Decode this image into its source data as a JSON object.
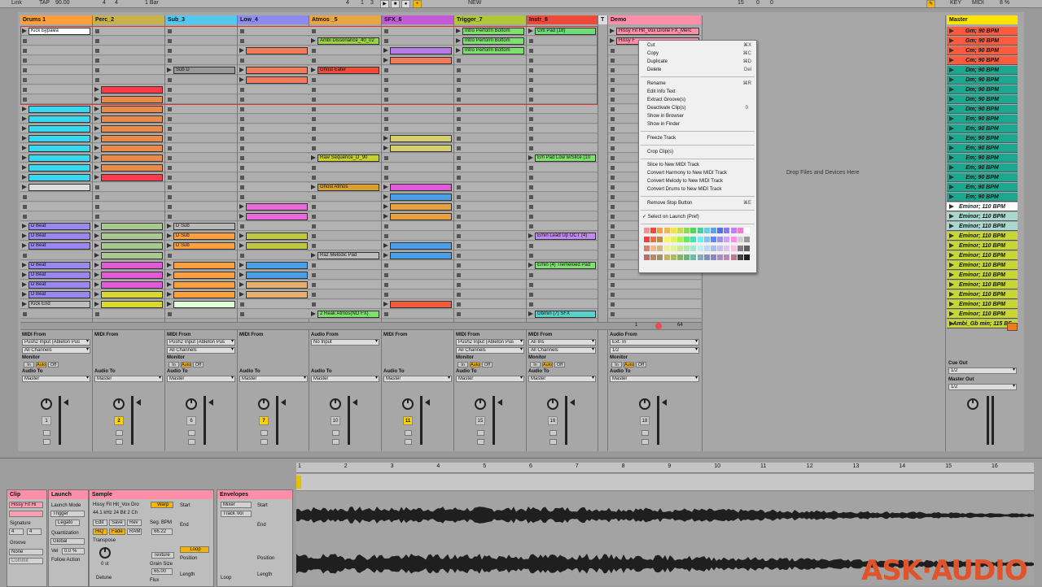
{
  "transport": {
    "link": "Link",
    "tap": "TAP",
    "tempo": "90.00",
    "sig1": "4",
    "sig2": "4",
    "quant": "1 Bar",
    "pos1": "4",
    "pos2": "1",
    "pos3": "3",
    "new_label": "NEW",
    "pos_r1": "15",
    "pos_r2": "0",
    "pos_r3": "0",
    "key_label": "KEY",
    "midi_label": "MIDI",
    "cpu": "8 %"
  },
  "tracks": [
    {
      "name": "Drums 1",
      "color": "#ff9f3a"
    },
    {
      "name": "Perc_2",
      "color": "#c9b24a"
    },
    {
      "name": "Sub_3",
      "color": "#55c8f0"
    },
    {
      "name": "Low_4",
      "color": "#8c8cf0"
    },
    {
      "name": "Atmos _5",
      "color": "#e8a640"
    },
    {
      "name": "SFX_6",
      "color": "#c35ad8"
    },
    {
      "name": "Trigger_7",
      "color": "#b0c838"
    },
    {
      "name": "Instr_8",
      "color": "#ee4a3a"
    },
    {
      "name": "T",
      "color": "#dddddd"
    },
    {
      "name": "Demo",
      "color": "#ff8fa8"
    }
  ],
  "master_name": "Master",
  "clip_names": {
    "kick_byrama": "Kick Бурама",
    "ambi_dissonance": "Ambi Dissonance_40_02",
    "intro_perform_1": "Intro Perform Bottom",
    "intro_perform_2": "Intro Perform Bottom",
    "intro_perform_3": "Intro Perform Bottom",
    "gm_pad": "Gm Pad (18)",
    "demo_1": "Hissy Fit Hit_Vox Drone FX_Merc",
    "demo_2": "Hissy F",
    "sub_d": "Sub D",
    "ghost_eater": "Ghost Eater",
    "raw_sequence": "Raw Sequence_D_90",
    "em_pad_low": "Em Pad Low w/Slice (10",
    "ghost_atmos": "Ghost Atmos",
    "d_beat_1": "D Beat",
    "d_beat_2": "D Beat",
    "d_beat_3": "D Beat",
    "d_sub_1": "D Sub",
    "d_sub_2": "D Sub",
    "d_sub_3": "D Sub",
    "emin_lead": "Emin Lead Up OCT (4)",
    "raz_melodic": "Raz Melodic Pad",
    "d_beat_4": "D Beat",
    "d_beat_5": "D Beat",
    "d_beat_6": "D Beat",
    "d_beat_7": "D Beat",
    "emin_tremeloed": "Emin (4) Tremeloed Pad",
    "kick_end": "Kick End",
    "reak_atmos": "2 Reak Atmos(NO FX)",
    "gbmin_sfx": "Gbmin (7) SFX"
  },
  "drop_hint": "Drop Files and Devices Here",
  "scenes": [
    {
      "label": "Gm; 90 BPM",
      "color": "#ff5a3c"
    },
    {
      "label": "Gm; 90 BPM",
      "color": "#ff5a3c"
    },
    {
      "label": "Cm; 90 BPM",
      "color": "#ff5a3c"
    },
    {
      "label": "Cm; 90 BPM",
      "color": "#ff5a3c"
    },
    {
      "label": "Dm; 90 BPM",
      "color": "#1aa890"
    },
    {
      "label": "Dm; 90 BPM",
      "color": "#1aa890"
    },
    {
      "label": "Dm; 90 BPM",
      "color": "#1aa890"
    },
    {
      "label": "Dm; 90 BPM",
      "color": "#1aa890"
    },
    {
      "label": "Dm; 90 BPM",
      "color": "#1aa890"
    },
    {
      "label": "Em; 90 BPM",
      "color": "#1aa890"
    },
    {
      "label": "Em; 90 BPM",
      "color": "#1aa890"
    },
    {
      "label": "Em; 90 BPM",
      "color": "#1aa890"
    },
    {
      "label": "Em; 90 BPM",
      "color": "#1aa890"
    },
    {
      "label": "Em; 90 BPM",
      "color": "#1aa890"
    },
    {
      "label": "Em; 90 BPM",
      "color": "#1aa890"
    },
    {
      "label": "Em; 90 BPM",
      "color": "#1aa890"
    },
    {
      "label": "Em; 90 BPM",
      "color": "#1aa890"
    },
    {
      "label": "Em; 90 BPM",
      "color": "#1aa890"
    },
    {
      "label": "Eminor; 110 BPM",
      "color": "#ffffff"
    },
    {
      "label": "Eminor; 110 BPM",
      "color": "#a8d8d0"
    },
    {
      "label": "Eminor; 110 BPM",
      "color": "#a8d8d0"
    },
    {
      "label": "Eminor; 110 BPM",
      "color": "#c8d630"
    },
    {
      "label": "Eminor; 110 BPM",
      "color": "#c8d630"
    },
    {
      "label": "Eminor; 110 BPM",
      "color": "#c8d630"
    },
    {
      "label": "Eminor; 110 BPM",
      "color": "#c8d630"
    },
    {
      "label": "Eminor; 110 BPM",
      "color": "#c8d630"
    },
    {
      "label": "Eminor; 110 BPM",
      "color": "#c8d630"
    },
    {
      "label": "Eminor; 110 BPM",
      "color": "#c8d630"
    },
    {
      "label": "Eminor; 110 BPM",
      "color": "#c8d630"
    },
    {
      "label": "Eminor; 110 BPM",
      "color": "#c8d630"
    },
    {
      "label": "Ambi_Gb min; 115 BF",
      "color": "#c8d630"
    }
  ],
  "io": {
    "midi_from": "MIDI From",
    "audio_from": "Audio From",
    "audio_to": "Audio To",
    "monitor": "Monitor",
    "in": "In",
    "auto": "Auto",
    "off": "Off",
    "push2": "Push2 Input (Ableton Pus",
    "all_channels": "All Channels",
    "no_input": "No Input",
    "all_ins": "All Ins",
    "ext_in": "Ext. In",
    "half": "1/2",
    "master": "Master",
    "cue_out": "Cue Out",
    "master_out": "Master Out",
    "demo_num1": "1",
    "demo_num2": "64"
  },
  "track_numbers": [
    "1",
    "2",
    "6",
    "7",
    "10",
    "11",
    "15",
    "16",
    "17",
    "18"
  ],
  "context_menu": {
    "cut": "Cut",
    "cut_sc": "⌘X",
    "copy": "Copy",
    "copy_sc": "⌘C",
    "duplicate": "Duplicate",
    "duplicate_sc": "⌘D",
    "delete": "Delete",
    "delete_sc": "Del",
    "rename": "Rename",
    "rename_sc": "⌘R",
    "edit_info": "Edit Info Text",
    "extract_grooves": "Extract Groove(s)",
    "deactivate": "Deactivate Clip(s)",
    "deactivate_sc": "0",
    "show_browser": "Show in Browser",
    "show_finder": "Show in Finder",
    "freeze": "Freeze Track",
    "crop": "Crop Clip(s)",
    "slice": "Slice to New MIDI Track",
    "conv_harmony": "Convert Harmony to New MIDI Track",
    "conv_melody": "Convert Melody to New MIDI Track",
    "conv_drums": "Convert Drums to New MIDI Track",
    "remove_stop": "Remove Stop Button",
    "remove_stop_sc": "⌘E",
    "select_launch": "✓ Select on Launch (Pref)"
  },
  "palette": [
    "#ff8f8f",
    "#f24a3a",
    "#f5a23b",
    "#eeb956",
    "#f2e447",
    "#ccd952",
    "#8fd95a",
    "#57d35e",
    "#3bd3a0",
    "#5cd4e8",
    "#4fa6f5",
    "#4f6ef0",
    "#8a78f0",
    "#c17ff2",
    "#f07ccf",
    "#ffffff",
    "#ff3a3a",
    "#f0703a",
    "#c48a3a",
    "#fff36b",
    "#dff45a",
    "#a9f24b",
    "#66e66a",
    "#4ae0b3",
    "#66f0ff",
    "#7ac4ff",
    "#5b88ff",
    "#9f8cff",
    "#d79cff",
    "#ff8ee6",
    "#cfcfcf",
    "#9a9a9a",
    "#e07c6a",
    "#fbb58a",
    "#d8b684",
    "#f5f0a0",
    "#e1f3a1",
    "#cbe6a1",
    "#b6e8b6",
    "#a4e8d3",
    "#c0eef5",
    "#b7daf6",
    "#a8bff2",
    "#c7bdf2",
    "#e1c2f3",
    "#f3c3e6",
    "#7d7d7d",
    "#5f5f5f",
    "#bd6b66",
    "#b88a63",
    "#a08f6b",
    "#c2b56b",
    "#a9b86b",
    "#87b069",
    "#73b080",
    "#6fb7a8",
    "#84a9c2",
    "#7d8fbd",
    "#8a86c1",
    "#a88ac6",
    "#bb8ab4",
    "#b87a8f",
    "#404040",
    "#1e1e1e"
  ],
  "detail": {
    "clip_title": "Clip",
    "clip_name": "Hissy Fit Hi",
    "signature": "Signature",
    "sig_num": "4",
    "sig_den": "4",
    "groove": "Groove",
    "groove_val": "None",
    "commit": "Commit",
    "launch_title": "Launch",
    "launch_mode": "Launch Mode",
    "launch_mode_val": "Trigger",
    "legato": "Legato",
    "quantization": "Quantization",
    "quant_val": "Global",
    "velocity": "Vel",
    "vel_val": "0.0 %",
    "follow_action": "Follow Action",
    "sample_title": "Sample",
    "sample_name": "Hissy Fit Hit_Vox Dro",
    "sample_info": "44.1 kHz 24 Bit 2 Ch",
    "edit": "Edit",
    "save": "Save",
    "rev": "Rev",
    "hiq": "HiQ",
    "fade": "Fade",
    "ram": "RAM",
    "transpose": "Transpose",
    "transpose_val": "0 st",
    "detune": "Detune",
    "warp": "Warp",
    "seg_bpm": "Seg. BPM",
    "seg_bpm_val": "66.22",
    "texture": "Texture",
    "grain_size": "Grain Size",
    "grain_val": "65.00",
    "flux": "Flux",
    "start": "Start",
    "end": "End",
    "loop": "Loop",
    "position": "Position",
    "length": "Length",
    "envelopes_title": "Envelopes",
    "env_mixer": "Mixer",
    "env_track": "Track Vol"
  },
  "ruler": [
    "1",
    "2",
    "3",
    "4",
    "5",
    "6",
    "7",
    "8",
    "9",
    "10",
    "11",
    "12",
    "13",
    "14",
    "15",
    "16"
  ],
  "watermark": "ASK·AUDIO"
}
